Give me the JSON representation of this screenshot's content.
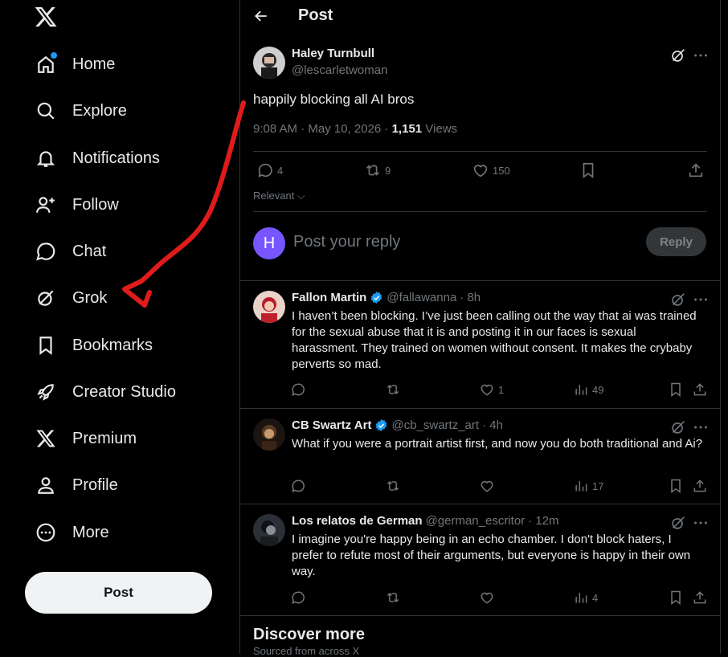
{
  "sidebar": {
    "logo_icon": "x-logo-icon",
    "items": [
      {
        "label": "Home",
        "icon": "home-icon"
      },
      {
        "label": "Explore",
        "icon": "search-icon"
      },
      {
        "label": "Notifications",
        "icon": "bell-icon"
      },
      {
        "label": "Follow",
        "icon": "person-plus-icon"
      },
      {
        "label": "Chat",
        "icon": "chat-bubble-icon"
      },
      {
        "label": "Grok",
        "icon": "grok-icon"
      },
      {
        "label": "Bookmarks",
        "icon": "bookmark-icon"
      },
      {
        "label": "Creator Studio",
        "icon": "rocket-icon"
      },
      {
        "label": "Premium",
        "icon": "x-logo-icon"
      },
      {
        "label": "Profile",
        "icon": "person-icon"
      },
      {
        "label": "More",
        "icon": "more-circle-icon"
      }
    ],
    "post_button": "Post"
  },
  "header": {
    "title": "Post"
  },
  "post": {
    "author_name": "Haley Turnbull",
    "author_handle": "@lescarletwoman",
    "text": "happily blocking all AI bros",
    "timestamp": "9:08 AM · May 10, 2026 · ",
    "views_count": "1,151",
    "views_label": " Views",
    "replies": "4",
    "reposts": "9",
    "likes": "150",
    "sort_label": "Relevant"
  },
  "composer": {
    "avatar_letter": "H",
    "placeholder": "Post your reply",
    "reply_button": "Reply"
  },
  "replies": [
    {
      "name": "Fallon Martin",
      "handle": "@fallawanna",
      "time": "· 8h",
      "text": "I haven’t been blocking. I’ve just been calling out the way that ai was trained for the sexual abuse that it is and posting it in our faces is sexual harassment. They trained on women without consent. It makes the crybaby perverts so mad.",
      "likes": "1",
      "views": "49"
    },
    {
      "name": "CB Swartz Art",
      "handle": "@cb_swartz_art",
      "time": "· 4h",
      "text": "What if you were a portrait artist first, and now you do both traditional and Ai?",
      "likes": "",
      "views": "17"
    },
    {
      "name": "Los relatos de German",
      "handle": "@german_escritor",
      "time": "· 12m",
      "text": "I imagine you're happy being in an echo chamber. I don't block haters, I prefer to refute most of their arguments, but everyone is happy in their own way.",
      "likes": "",
      "views": "4"
    }
  ],
  "discover": {
    "title": "Discover more",
    "subtitle": "Sourced from across X"
  },
  "colors": {
    "accent": "#1d9bf0",
    "annotation_red": "#e01b1b",
    "composer_avatar": "#7856ff"
  }
}
